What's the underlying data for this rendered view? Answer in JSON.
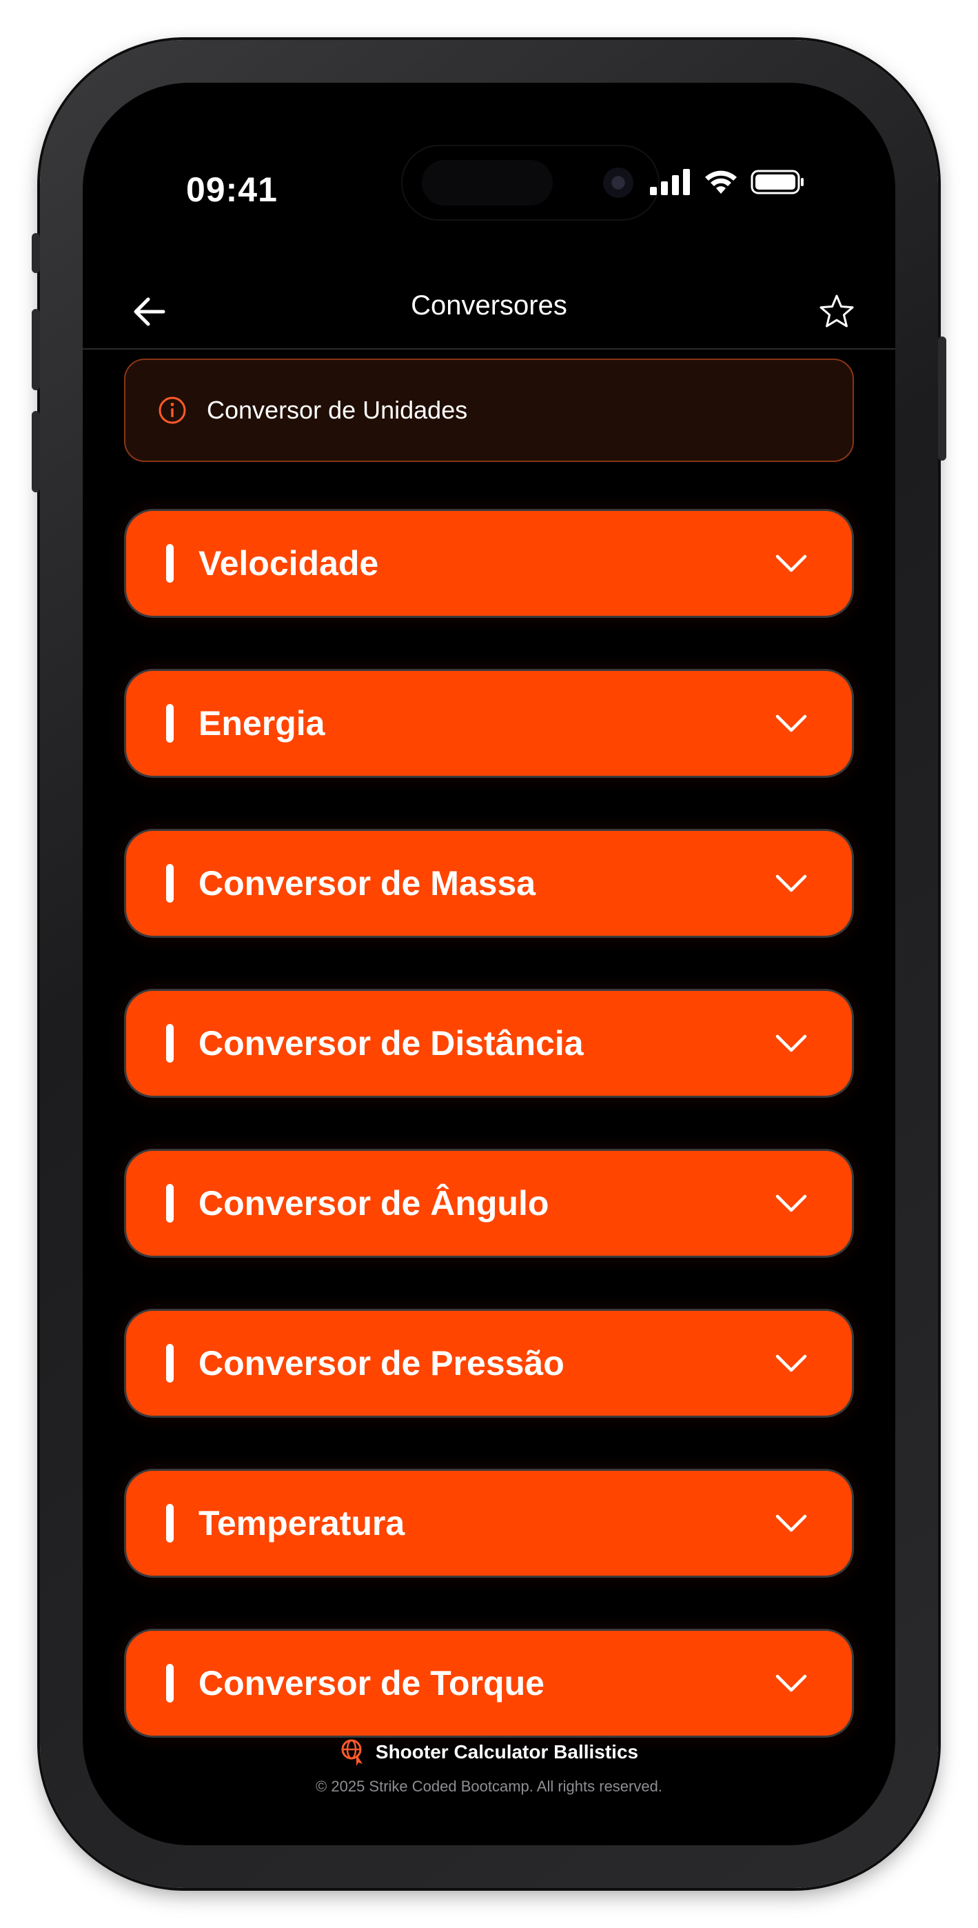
{
  "status_bar": {
    "time": "09:41"
  },
  "header": {
    "title": "Conversores"
  },
  "info_banner": {
    "text": "Conversor de Unidades"
  },
  "converters": [
    {
      "label": "Velocidade"
    },
    {
      "label": "Energia"
    },
    {
      "label": "Conversor de Massa"
    },
    {
      "label": "Conversor de Distância"
    },
    {
      "label": "Conversor de Ângulo"
    },
    {
      "label": "Conversor de Pressão"
    },
    {
      "label": "Temperatura"
    },
    {
      "label": "Conversor de Torque"
    }
  ],
  "footer": {
    "brand": "Shooter Calculator Ballistics",
    "copyright": "© 2025 Strike Coded Bootcamp. All rights reserved."
  },
  "colors": {
    "accent": "#ff4500",
    "background": "#000000",
    "banner_bg": "#200e06",
    "banner_border": "#8a3515"
  },
  "icons": {
    "back": "arrow-left-icon",
    "favorite": "star-outline-icon",
    "info": "info-circle-icon",
    "expand": "chevron-down-icon",
    "brand": "crosshair-globe-icon"
  }
}
